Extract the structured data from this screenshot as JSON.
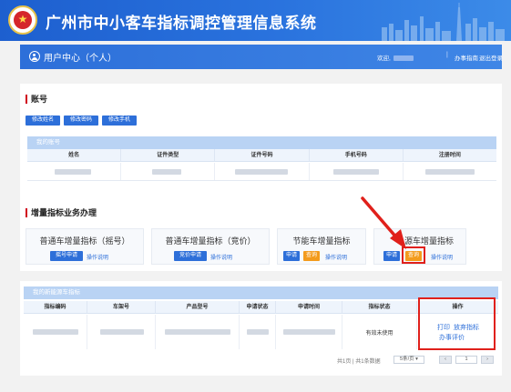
{
  "header": {
    "title": "广州市中小客车指标调控管理信息系统",
    "user_center": "用户中心（个人）",
    "welcome": "欢迎,",
    "guide_link": "办事指南",
    "logout_link": "退出登录"
  },
  "account": {
    "section_title": "账号",
    "buttons": [
      "修改姓名",
      "修改密码",
      "修改手机"
    ],
    "table_title": "我的账号",
    "columns": [
      "姓名",
      "证件类型",
      "证件号码",
      "手机号码",
      "注册时间"
    ]
  },
  "business": {
    "section_title": "增量指标业务办理",
    "cards": [
      {
        "title": "普通车增量指标（摇号）",
        "primary": "摇号申请",
        "link": "操作说明"
      },
      {
        "title": "普通车增量指标（竞价）",
        "primary": "竞价申请",
        "link": "操作说明"
      },
      {
        "title": "节能车增量指标",
        "apply": "申请",
        "query": "查询",
        "link": "操作说明"
      },
      {
        "title": "源车增量指标",
        "apply": "申请",
        "query": "查询",
        "link": "操作说明"
      }
    ]
  },
  "new_energy": {
    "table_title": "我的新能源车指标",
    "columns": [
      "指标编码",
      "车架号",
      "产品型号",
      "申请状态",
      "申请时间",
      "指标状态",
      "操作"
    ],
    "row": {
      "status": "有效未使用",
      "actions": {
        "print": "打印",
        "give_up": "放弃指标",
        "evaluate": "办事评价"
      }
    },
    "pager": {
      "summary": "共1页 | 共1条数据",
      "page_size": "5条/页",
      "page_input": "1"
    }
  },
  "colors": {
    "primary_blue": "#2d6fd9",
    "orange": "#f39b1c",
    "highlight_red": "#e0201b"
  }
}
